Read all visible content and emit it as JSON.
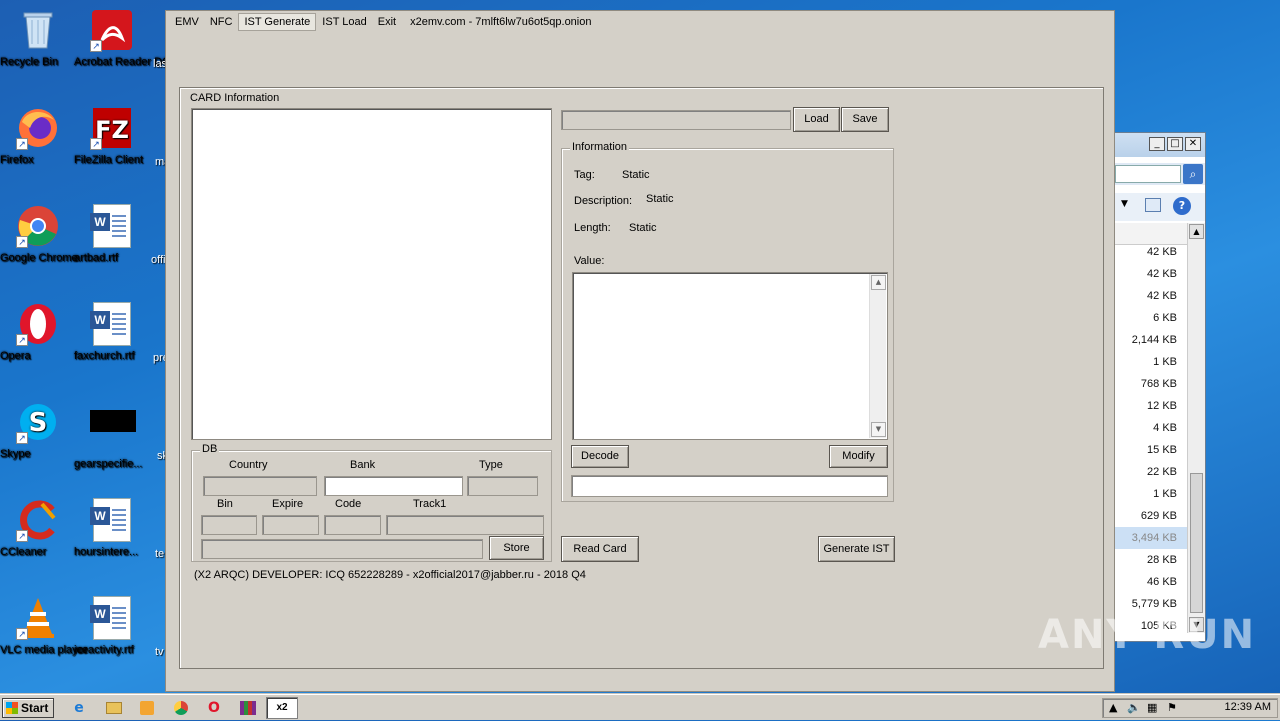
{
  "desktop": {
    "icons": [
      {
        "label": "Recycle Bin"
      },
      {
        "label": "Acrobat Reader DC"
      },
      {
        "label": "Firefox"
      },
      {
        "label": "FileZilla Client"
      },
      {
        "label": "Google Chrome"
      },
      {
        "label": "artbad.rtf"
      },
      {
        "label": "Opera"
      },
      {
        "label": "faxchurch.rtf"
      },
      {
        "label": "Skype"
      },
      {
        "label": "gearspecifie..."
      },
      {
        "label": "CCleaner"
      },
      {
        "label": "hoursintere..."
      },
      {
        "label": "VLC media player"
      },
      {
        "label": "iceactivity.rtf"
      }
    ],
    "clipped_labels": [
      "las",
      "ma",
      "offi",
      "pre",
      "sk",
      "te",
      "tv"
    ]
  },
  "explorer": {
    "sizes": [
      "42 KB",
      "42 KB",
      "42 KB",
      "6 KB",
      "2,144 KB",
      "1 KB",
      "768 KB",
      "12 KB",
      "4 KB",
      "15 KB",
      "22 KB",
      "1 KB",
      "629 KB",
      "3,494 KB",
      "28 KB",
      "46 KB",
      "5,779 KB",
      "105 KB"
    ],
    "selected_index": 13
  },
  "app": {
    "menu": [
      "EMV",
      "NFC",
      "IST Generate",
      "IST Load",
      "Exit"
    ],
    "active_menu": "IST Generate",
    "window_title": "x2emv.com - 7mlft6lw7u6ot5qp.onion",
    "card_info_title": "CARD Information",
    "file_path_value": "",
    "load_label": "Load",
    "save_label": "Save",
    "information": {
      "title": "Information",
      "tag_label": "Tag:",
      "tag_value": "Static",
      "description_label": "Description:",
      "description_value": "Static",
      "length_label": "Length:",
      "length_value": "Static",
      "value_label": "Value:",
      "decode_label": "Decode",
      "modify_label": "Modify",
      "result_value": ""
    },
    "db": {
      "title": "DB",
      "country_label": "Country",
      "bank_label": "Bank",
      "type_label": "Type",
      "bin_label": "Bin",
      "expire_label": "Expire",
      "code_label": "Code",
      "track1_label": "Track1",
      "store_label": "Store"
    },
    "read_card_label": "Read Card",
    "generate_ist_label": "Generate IST",
    "footer_text": "(X2 ARQC) DEVELOPER: ICQ 652228289 - x2official2017@jabber.ru - 2018 Q4"
  },
  "taskbar": {
    "start_label": "Start",
    "active_app_label": "x2",
    "clock": "12:39 AM"
  },
  "watermark": "ANY RUN"
}
